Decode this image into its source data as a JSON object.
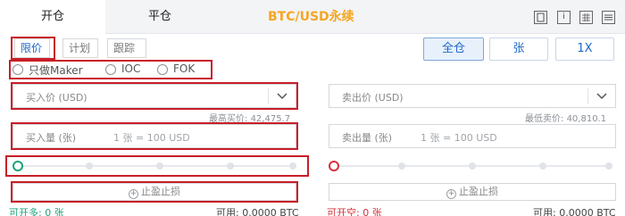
{
  "tabs": {
    "open": "开仓",
    "close": "平仓"
  },
  "pair_title": "BTC/USD永续",
  "toolbar_icons": [
    "bookmark-icon",
    "info-icon",
    "calculator-icon",
    "settings-icon"
  ],
  "order_types": {
    "limit": "限价",
    "plan": "计划",
    "trailing": "跟踪"
  },
  "margin_mode": {
    "cross": "全仓",
    "unit": "张",
    "leverage": "1X"
  },
  "options": {
    "maker_only": "只做Maker",
    "ioc": "IOC",
    "fok": "FOK"
  },
  "buy": {
    "price_label": "买入价 (USD)",
    "max_price_label": "最高买价:",
    "max_price_value": "42,475.7",
    "qty_label": "买入量 (张)",
    "qty_hint": "1 张 = 100 USD",
    "tpsl_label": "止盈止损",
    "can_open_label": "可开多:",
    "can_open_value": "0 张",
    "available_label": "可用:",
    "available_value": "0.0000 BTC"
  },
  "sell": {
    "price_label": "卖出价 (USD)",
    "min_price_label": "最低卖价:",
    "min_price_value": "40,810.1",
    "qty_label": "卖出量 (张)",
    "qty_hint": "1 张 = 100 USD",
    "tpsl_label": "止盈止损",
    "can_open_label": "可开空:",
    "can_open_value": "0 张",
    "available_label": "可用:",
    "available_value": "0.0000 BTC"
  },
  "colors": {
    "buy": "#1aa37a",
    "sell": "#d6303b",
    "accent": "#1e67c8",
    "highlight_box": "#c81e28",
    "title": "#f5a623"
  }
}
